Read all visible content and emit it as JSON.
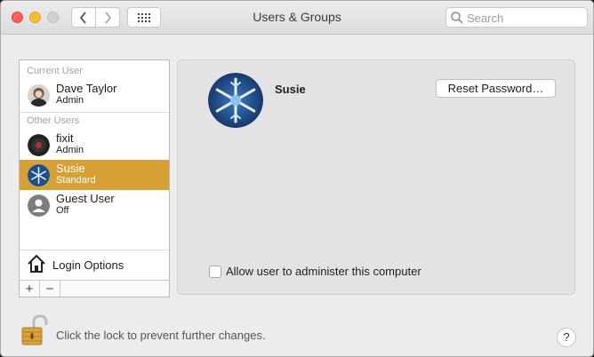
{
  "window": {
    "title": "Users & Groups"
  },
  "search": {
    "placeholder": "Search"
  },
  "sidebar": {
    "current_header": "Current User",
    "other_header": "Other Users",
    "current_user": {
      "name": "Dave Taylor",
      "role": "Admin"
    },
    "other_users": [
      {
        "name": "fixit",
        "role": "Admin"
      },
      {
        "name": "Susie",
        "role": "Standard",
        "selected": true
      },
      {
        "name": "Guest User",
        "role": "Off"
      }
    ],
    "login_options": "Login Options",
    "add_label": "+",
    "remove_label": "−"
  },
  "detail": {
    "user_name": "Susie",
    "reset_button": "Reset Password…",
    "admin_checkbox_label": "Allow user to administer this computer",
    "admin_checked": false
  },
  "footer": {
    "lock_text": "Click the lock to prevent further changes.",
    "help": "?"
  },
  "colors": {
    "selection": "#d6a034",
    "close": "#fc5f57",
    "minimize": "#fdbc2e"
  }
}
